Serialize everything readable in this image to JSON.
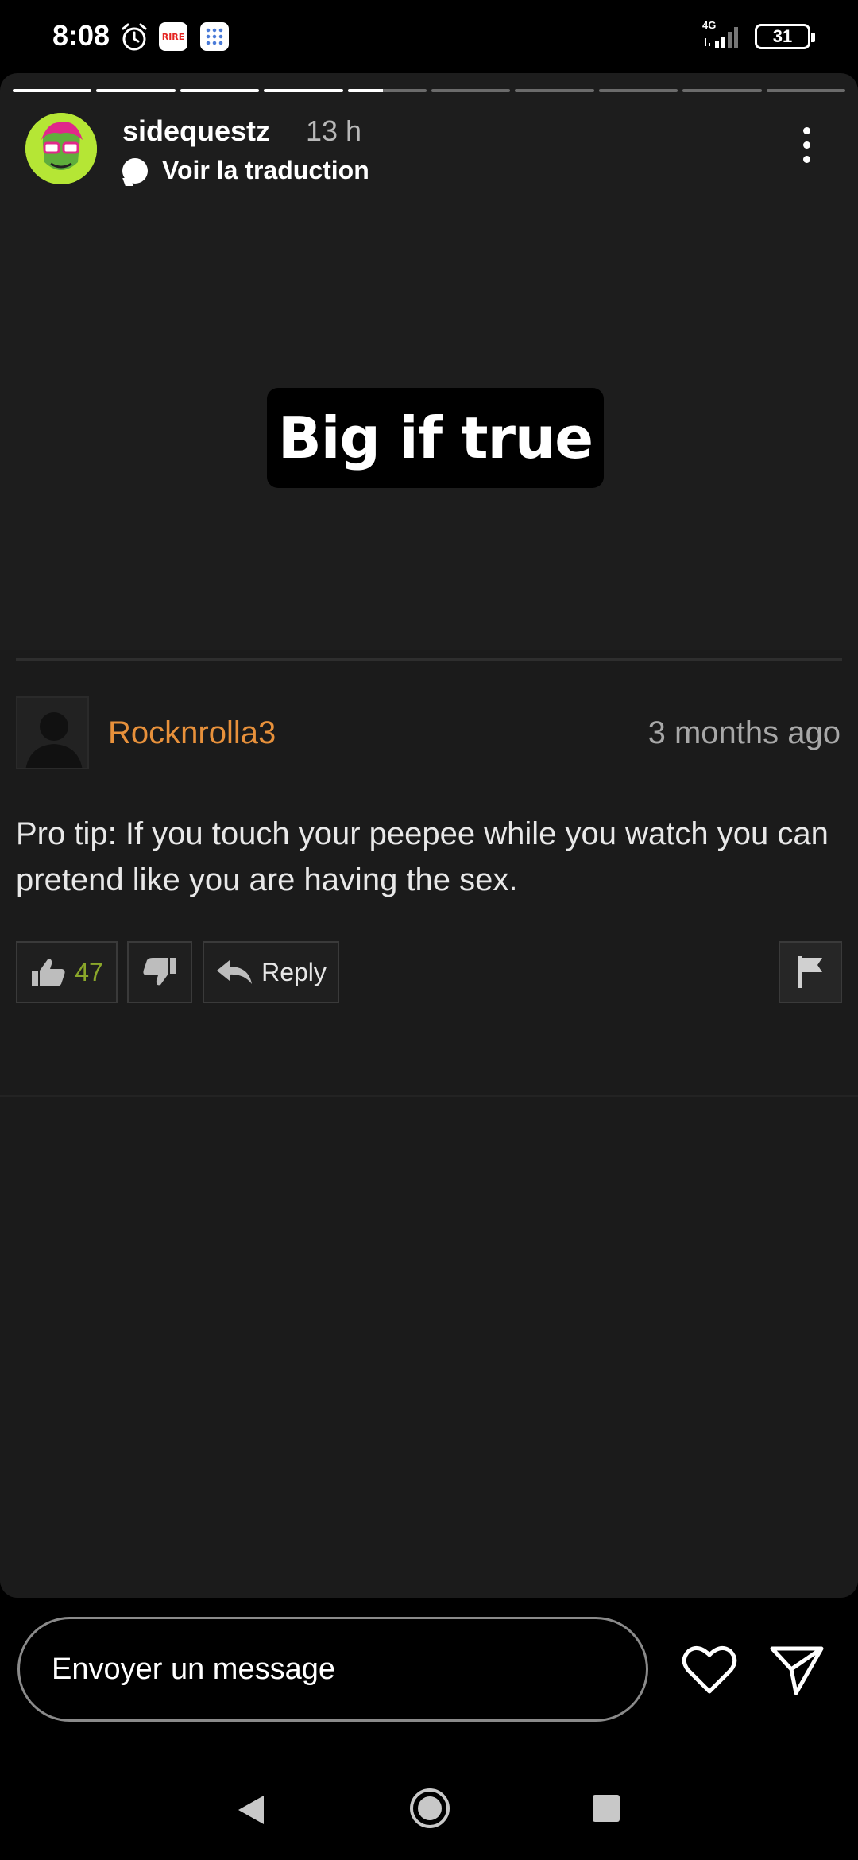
{
  "status_bar": {
    "time": "8:08",
    "network": "4G",
    "battery": "31",
    "rire_label": "RIRE"
  },
  "story": {
    "progress_segments": [
      {
        "fill": 1
      },
      {
        "fill": 1
      },
      {
        "fill": 1
      },
      {
        "fill": 1
      },
      {
        "fill": 0.45
      },
      {
        "fill": 0
      },
      {
        "fill": 0
      },
      {
        "fill": 0
      },
      {
        "fill": 0
      },
      {
        "fill": 0
      }
    ],
    "username": "sidequestz",
    "time_ago": "13 h",
    "translate_label": "Voir la traduction",
    "sticker_text": "Big if true"
  },
  "comment": {
    "author": "Rocknrolla3",
    "posted": "3 months ago",
    "text": "Pro tip: If you touch your peepee while you watch you can pretend like you are having the sex.",
    "likes": "47",
    "reply_label": "Reply",
    "colors": {
      "author": "#e8913b",
      "likes": "#8aa62a"
    }
  },
  "composer": {
    "placeholder": "Envoyer un message"
  },
  "icons": {
    "like": "thumbs-up-icon",
    "dislike": "thumbs-down-icon",
    "reply": "reply-arrow-icon",
    "flag": "flag-icon",
    "heart": "heart-icon",
    "send": "send-icon",
    "more": "more-vertical-icon"
  }
}
